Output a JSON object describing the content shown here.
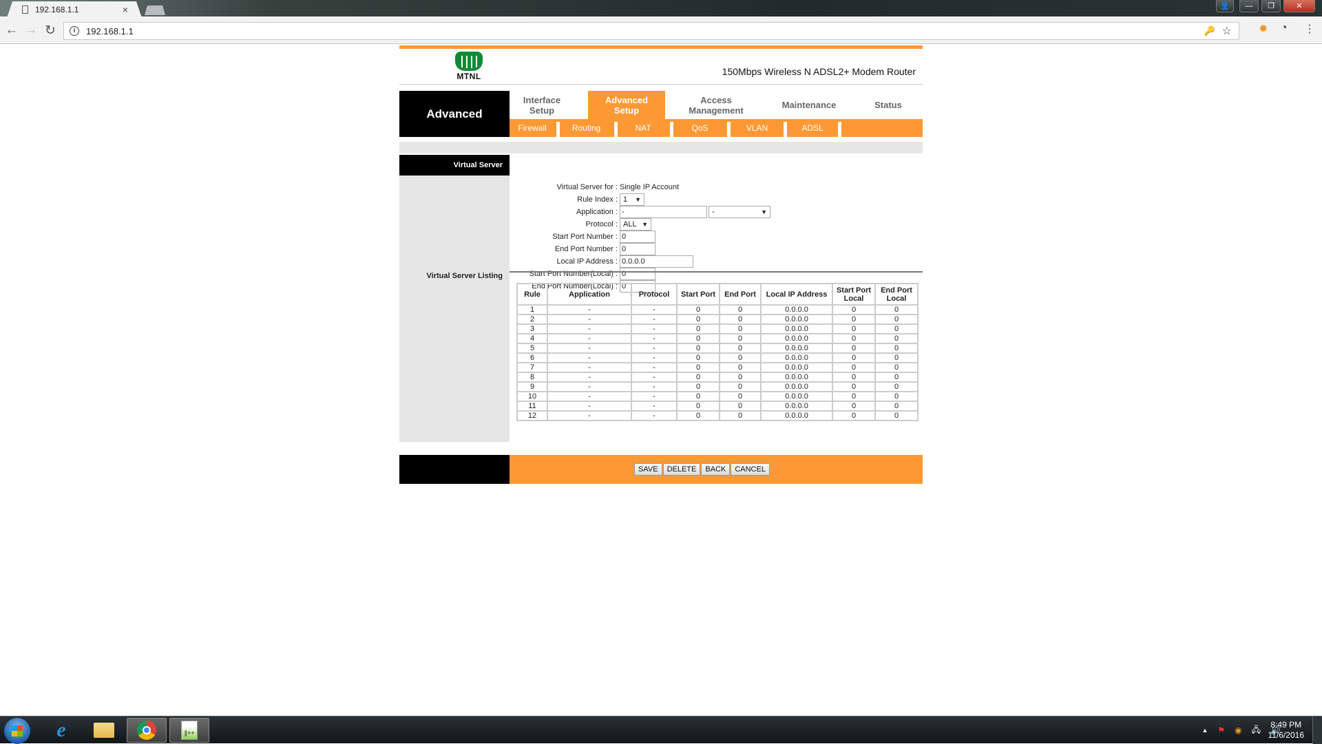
{
  "browser": {
    "tab_title": "192.168.1.1",
    "tab_icon": "document-icon",
    "close_tab": "×",
    "address": "192.168.1.1",
    "icons": {
      "back": "←",
      "forward": "→",
      "reload": "↻",
      "info": "i",
      "key": "🔑",
      "star": "☆",
      "avast": "✹",
      "speed": "◔",
      "menu": "⋮"
    },
    "window": {
      "user": "👤",
      "min": "—",
      "max": "❐",
      "close": "✕"
    }
  },
  "header": {
    "brand": "MTNL",
    "model": "150Mbps Wireless N ADSL2+ Modem Router"
  },
  "nav": {
    "section_title": "Advanced",
    "tabs": [
      {
        "label": "Interface\nSetup",
        "line1": "Interface",
        "line2": "Setup",
        "active": false
      },
      {
        "label": "Advanced Setup",
        "line1": "Advanced",
        "line2": "Setup",
        "active": true
      },
      {
        "label": "Access Management",
        "line1": "Access",
        "line2": "Management",
        "active": false
      },
      {
        "label": "Maintenance",
        "line1": "Maintenance",
        "line2": "",
        "active": false
      },
      {
        "label": "Status",
        "line1": "Status",
        "line2": "",
        "active": false
      }
    ],
    "subtabs": [
      "Firewall",
      "Routing",
      "NAT",
      "QoS",
      "VLAN",
      "ADSL"
    ]
  },
  "sidebar": {
    "section": "Virtual Server",
    "listing_label": "Virtual Server Listing"
  },
  "form": {
    "virtual_server_for": {
      "label": "Virtual Server for",
      "value": "Single IP Account"
    },
    "rule_index": {
      "label": "Rule Index",
      "value": "1"
    },
    "application": {
      "label": "Application",
      "value": "-",
      "select_value": "-"
    },
    "protocol": {
      "label": "Protocol",
      "value": "ALL"
    },
    "start_port": {
      "label": "Start Port Number",
      "value": "0"
    },
    "end_port": {
      "label": "End Port Number",
      "value": "0"
    },
    "local_ip": {
      "label": "Local IP Address",
      "value": "0.0.0.0"
    },
    "start_port_local": {
      "label": "Start Port Number(Local)",
      "value": "0"
    },
    "end_port_local": {
      "label": "End Port Number(Local)",
      "value": "0"
    },
    "separator": ":"
  },
  "table": {
    "headers": [
      "Rule",
      "Application",
      "Protocol",
      "Start Port",
      "End Port",
      "Local IP Address",
      "Start Port Local",
      "End Port Local"
    ],
    "rows": [
      [
        "1",
        "-",
        "-",
        "0",
        "0",
        "0.0.0.0",
        "0",
        "0"
      ],
      [
        "2",
        "-",
        "-",
        "0",
        "0",
        "0.0.0.0",
        "0",
        "0"
      ],
      [
        "3",
        "-",
        "-",
        "0",
        "0",
        "0.0.0.0",
        "0",
        "0"
      ],
      [
        "4",
        "-",
        "-",
        "0",
        "0",
        "0.0.0.0",
        "0",
        "0"
      ],
      [
        "5",
        "-",
        "-",
        "0",
        "0",
        "0.0.0.0",
        "0",
        "0"
      ],
      [
        "6",
        "-",
        "-",
        "0",
        "0",
        "0.0.0.0",
        "0",
        "0"
      ],
      [
        "7",
        "-",
        "-",
        "0",
        "0",
        "0.0.0.0",
        "0",
        "0"
      ],
      [
        "8",
        "-",
        "-",
        "0",
        "0",
        "0.0.0.0",
        "0",
        "0"
      ],
      [
        "9",
        "-",
        "-",
        "0",
        "0",
        "0.0.0.0",
        "0",
        "0"
      ],
      [
        "10",
        "-",
        "-",
        "0",
        "0",
        "0.0.0.0",
        "0",
        "0"
      ],
      [
        "11",
        "-",
        "-",
        "0",
        "0",
        "0.0.0.0",
        "0",
        "0"
      ],
      [
        "12",
        "-",
        "-",
        "0",
        "0",
        "0.0.0.0",
        "0",
        "0"
      ]
    ]
  },
  "buttons": {
    "save": "SAVE",
    "delete": "DELETE",
    "back": "BACK",
    "cancel": "CANCEL"
  },
  "taskbar": {
    "apps": [
      "start-button",
      "internet-explorer",
      "file-explorer",
      "chrome",
      "notepad-plus-plus"
    ],
    "clock_time": "8:49 PM",
    "clock_date": "11/6/2016",
    "tray_icons": {
      "show_hidden": "▲",
      "action_center": "⚑",
      "avast": "◉",
      "network": "🖧",
      "volume": "🔊"
    }
  },
  "colors": {
    "accent": "#fd9934",
    "dark": "#000000",
    "panel_gray": "#e6e6e6",
    "logo_green": "#0f8a36"
  }
}
